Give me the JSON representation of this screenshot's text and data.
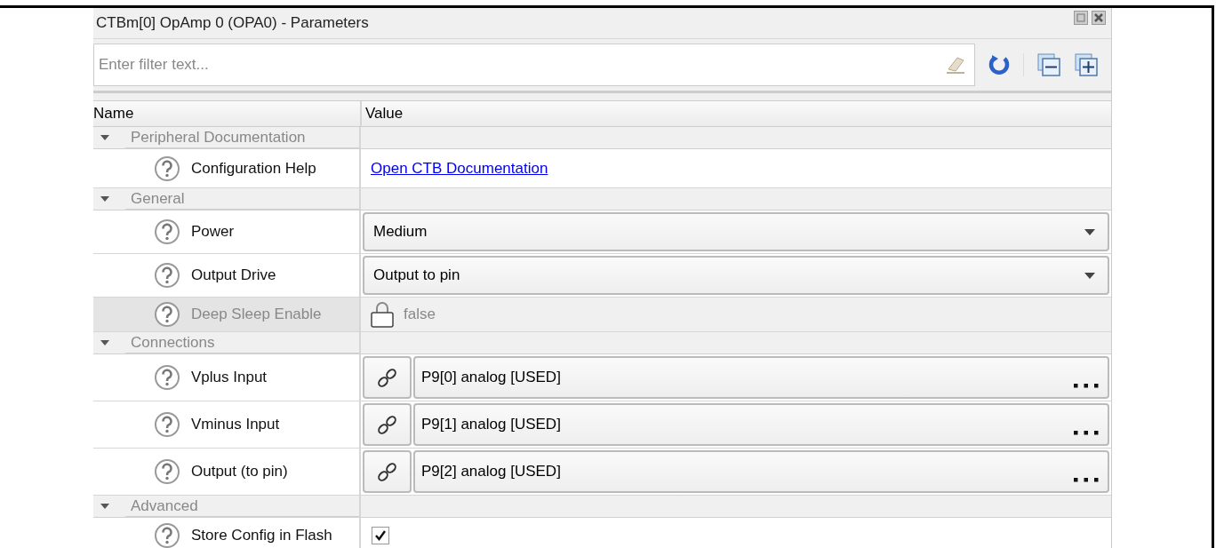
{
  "window": {
    "title": "CTBm[0] OpAmp 0 (OPA0) - Parameters"
  },
  "filter": {
    "placeholder": "Enter filter text..."
  },
  "columns": [
    "Name",
    "Value"
  ],
  "groups": [
    {
      "name": "Peripheral Documentation",
      "expanded": true,
      "items": [
        {
          "kind": "link",
          "name": "Configuration Help",
          "value": "Open CTB Documentation",
          "disabled": false
        }
      ]
    },
    {
      "name": "General",
      "expanded": true,
      "items": [
        {
          "kind": "dropdown",
          "name": "Power",
          "value": "Medium",
          "disabled": false
        },
        {
          "kind": "dropdown",
          "name": "Output Drive",
          "value": "Output to pin",
          "disabled": false
        },
        {
          "kind": "locked",
          "name": "Deep Sleep Enable",
          "value": "false",
          "disabled": true
        }
      ]
    },
    {
      "name": "Connections",
      "expanded": true,
      "items": [
        {
          "kind": "pin",
          "name": "Vplus Input",
          "value": "P9[0] analog [USED]",
          "disabled": false
        },
        {
          "kind": "pin",
          "name": "Vminus Input",
          "value": "P9[1] analog [USED]",
          "disabled": false
        },
        {
          "kind": "pin",
          "name": "Output (to pin)",
          "value": "P9[2] analog [USED]",
          "disabled": false
        }
      ]
    },
    {
      "name": "Advanced",
      "expanded": true,
      "items": [
        {
          "kind": "checkbox",
          "name": "Store Config in Flash",
          "checked": true,
          "disabled": false
        }
      ]
    }
  ]
}
